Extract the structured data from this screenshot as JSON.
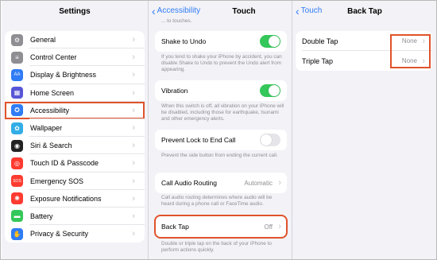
{
  "settings_panel": {
    "title": "Settings",
    "items": [
      {
        "label": "General",
        "icon": "gear-icon",
        "color": "#8e8e93",
        "glyph": "⚙"
      },
      {
        "label": "Control Center",
        "icon": "control-center-icon",
        "color": "#8e8e93",
        "glyph": "≡"
      },
      {
        "label": "Display & Brightness",
        "icon": "display-icon",
        "color": "#2f7cf6",
        "glyph": "AA"
      },
      {
        "label": "Home Screen",
        "icon": "home-screen-icon",
        "color": "#5856d6",
        "glyph": "▦"
      },
      {
        "label": "Accessibility",
        "icon": "accessibility-icon",
        "color": "#2f7cf6",
        "glyph": "✪"
      },
      {
        "label": "Wallpaper",
        "icon": "wallpaper-icon",
        "color": "#32ade6",
        "glyph": "✿"
      },
      {
        "label": "Siri & Search",
        "icon": "siri-icon",
        "color": "#222222",
        "glyph": "◉"
      },
      {
        "label": "Touch ID & Passcode",
        "icon": "fingerprint-icon",
        "color": "#ff3b30",
        "glyph": "◎"
      },
      {
        "label": "Emergency SOS",
        "icon": "sos-icon",
        "color": "#ff3b30",
        "glyph": "SOS"
      },
      {
        "label": "Exposure Notifications",
        "icon": "exposure-icon",
        "color": "#ff3b30",
        "glyph": "✺"
      },
      {
        "label": "Battery",
        "icon": "battery-icon",
        "color": "#34c759",
        "glyph": "▬"
      },
      {
        "label": "Privacy & Security",
        "icon": "hand-icon",
        "color": "#2f7cf6",
        "glyph": "✋"
      }
    ]
  },
  "touch_panel": {
    "back_label": "Accessibility",
    "title": "Touch",
    "top_note": "... to touches.",
    "shake_to_undo": {
      "label": "Shake to Undo",
      "note": "If you tend to shake your iPhone by accident, you can disable Shake to Undo to prevent the Undo alert from appearing."
    },
    "vibration": {
      "label": "Vibration",
      "note": "When this switch is off, all vibration on your iPhone will be disabled, including those for earthquake, tsunami and other emergency alerts."
    },
    "prevent_lock": {
      "label": "Prevent Lock to End Call",
      "note": "Prevent the side button from ending the current call."
    },
    "call_audio_routing": {
      "label": "Call Audio Routing",
      "value": "Automatic",
      "note": "Call audio routing determines where audio will be heard during a phone call or FaceTime audio."
    },
    "back_tap": {
      "label": "Back Tap",
      "value": "Off",
      "note": "Double or triple tap on the back of your iPhone to perform actions quickly."
    }
  },
  "back_tap_panel": {
    "back_label": "Touch",
    "title": "Back Tap",
    "double_tap": {
      "label": "Double Tap",
      "value": "None"
    },
    "triple_tap": {
      "label": "Triple Tap",
      "value": "None"
    }
  },
  "colors": {
    "accent": "#2f7cf6",
    "toggle_on": "#34c759",
    "highlight": "#e0532b"
  }
}
